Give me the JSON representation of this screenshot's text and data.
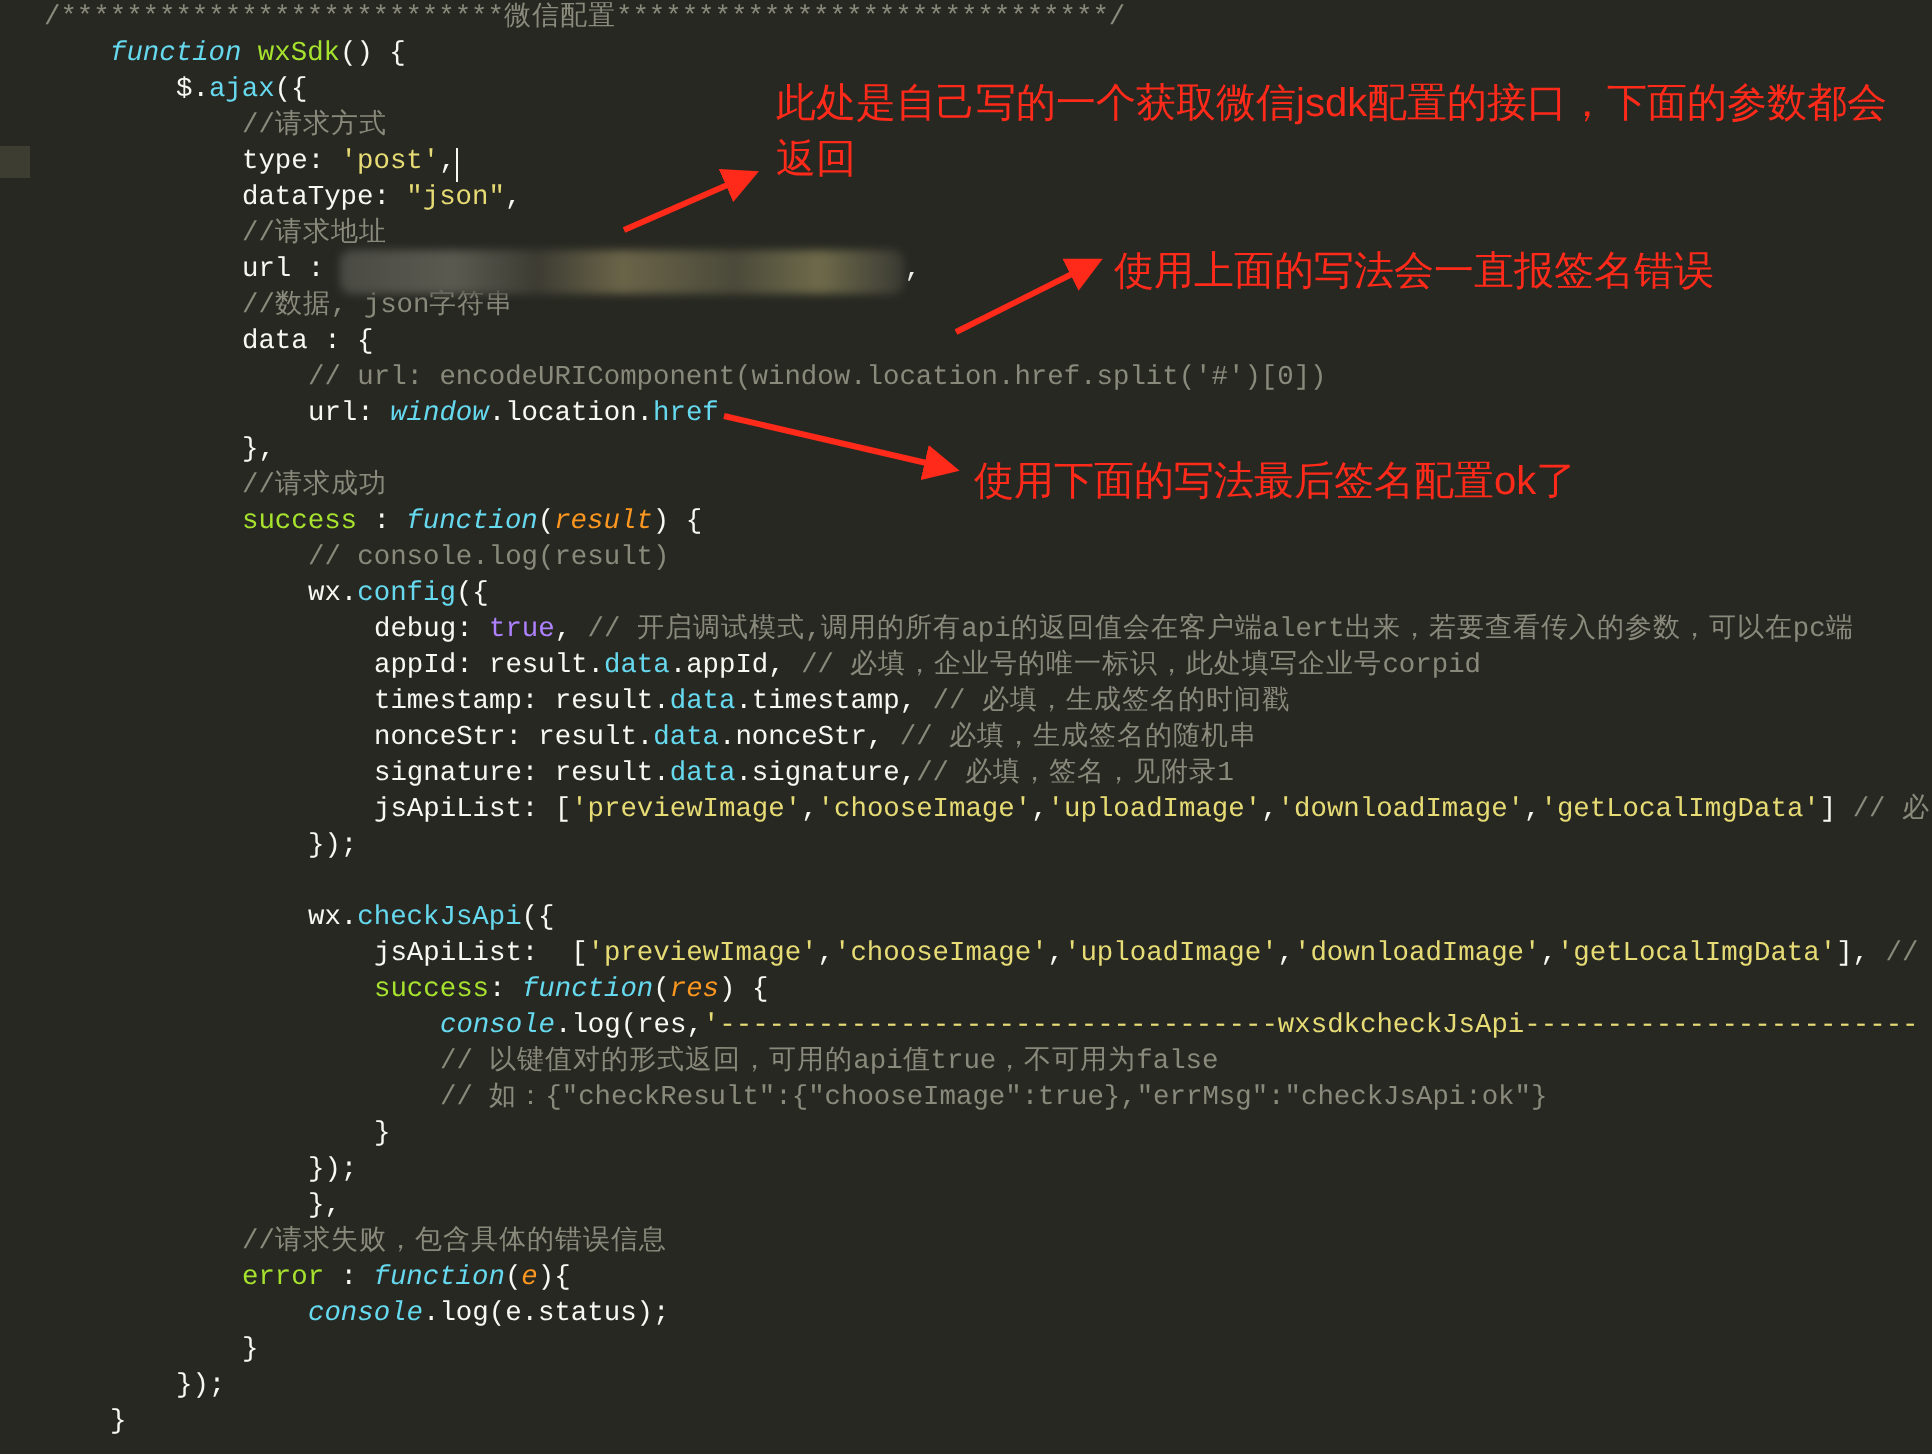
{
  "editor": {
    "lines": [
      {
        "kind": "code",
        "tokens": [
          {
            "kind": "comment",
            "text": "/***************************微信配置******************************/"
          }
        ],
        "children": [
          {
            "kind": "code",
            "tokens": [
              {
                "kind": "keyword",
                "text": "function"
              },
              {
                "kind": "name",
                "text": " wxSdk"
              },
              {
                "kind": "plain",
                "text": "() {"
              }
            ],
            "children": [
              {
                "kind": "code",
                "tokens": [
                  {
                    "kind": "plain",
                    "text": "$."
                  },
                  {
                    "kind": "prop",
                    "text": "ajax"
                  },
                  {
                    "kind": "plain",
                    "text": "({"
                  }
                ],
                "children": [
                  {
                    "kind": "code",
                    "tokens": [
                      {
                        "kind": "comment",
                        "text": "//请求方式"
                      }
                    ]
                  },
                  {
                    "kind": "code",
                    "tokens": [
                      {
                        "kind": "plain",
                        "text": "type: "
                      },
                      {
                        "kind": "string",
                        "text": "'post'"
                      },
                      {
                        "kind": "plain",
                        "text": ","
                      },
                      {
                        "kind": "cursor"
                      }
                    ]
                  },
                  {
                    "kind": "code",
                    "tokens": [
                      {
                        "kind": "plain",
                        "text": "dataType: "
                      },
                      {
                        "kind": "string",
                        "text": "\"json\""
                      },
                      {
                        "kind": "plain",
                        "text": ","
                      }
                    ]
                  },
                  {
                    "kind": "code",
                    "tokens": [
                      {
                        "kind": "comment",
                        "text": "//请求地址"
                      }
                    ]
                  },
                  {
                    "kind": "code",
                    "tokens": [
                      {
                        "kind": "plain",
                        "text": "url : "
                      },
                      {
                        "kind": "redacted"
                      },
                      {
                        "kind": "plain",
                        "text": ","
                      }
                    ]
                  },
                  {
                    "kind": "code",
                    "tokens": [
                      {
                        "kind": "comment",
                        "text": "//数据, json字符串"
                      }
                    ]
                  },
                  {
                    "kind": "code",
                    "tokens": [
                      {
                        "kind": "plain",
                        "text": "data : {"
                      }
                    ],
                    "children": [
                      {
                        "kind": "code",
                        "tokens": [
                          {
                            "kind": "comment",
                            "text": "// url: encodeURIComponent(window.location.href.split('#')[0])"
                          }
                        ]
                      },
                      {
                        "kind": "code",
                        "tokens": [
                          {
                            "kind": "plain",
                            "text": "url: "
                          },
                          {
                            "kind": "builtin",
                            "text": "window"
                          },
                          {
                            "kind": "plain",
                            "text": ".location."
                          },
                          {
                            "kind": "prop",
                            "text": "href"
                          }
                        ]
                      }
                    ]
                  },
                  {
                    "kind": "code",
                    "tokens": [
                      {
                        "kind": "plain",
                        "text": "},"
                      }
                    ]
                  },
                  {
                    "kind": "code",
                    "tokens": [
                      {
                        "kind": "comment",
                        "text": "//请求成功"
                      }
                    ]
                  },
                  {
                    "kind": "code",
                    "tokens": [
                      {
                        "kind": "name",
                        "text": "success"
                      },
                      {
                        "kind": "plain",
                        "text": " : "
                      },
                      {
                        "kind": "keyword",
                        "text": "function"
                      },
                      {
                        "kind": "plain",
                        "text": "("
                      },
                      {
                        "kind": "param",
                        "text": "result"
                      },
                      {
                        "kind": "plain",
                        "text": ") {"
                      }
                    ],
                    "children": [
                      {
                        "kind": "code",
                        "tokens": [
                          {
                            "kind": "comment",
                            "text": "// console.log(result)"
                          }
                        ]
                      },
                      {
                        "kind": "code",
                        "tokens": [
                          {
                            "kind": "plain",
                            "text": "wx."
                          },
                          {
                            "kind": "prop",
                            "text": "config"
                          },
                          {
                            "kind": "plain",
                            "text": "({"
                          }
                        ],
                        "children": [
                          {
                            "kind": "code",
                            "tokens": [
                              {
                                "kind": "plain",
                                "text": "debug: "
                              },
                              {
                                "kind": "constant",
                                "text": "true"
                              },
                              {
                                "kind": "plain",
                                "text": ", "
                              },
                              {
                                "kind": "comment",
                                "text": "// 开启调试模式,调用的所有api的返回值会在客户端alert出来，若要查看传入的参数，可以在pc端"
                              }
                            ]
                          },
                          {
                            "kind": "code",
                            "tokens": [
                              {
                                "kind": "plain",
                                "text": "appId: result."
                              },
                              {
                                "kind": "prop",
                                "text": "data"
                              },
                              {
                                "kind": "plain",
                                "text": ".appId, "
                              },
                              {
                                "kind": "comment",
                                "text": "// 必填，企业号的唯一标识，此处填写企业号corpid"
                              }
                            ]
                          },
                          {
                            "kind": "code",
                            "tokens": [
                              {
                                "kind": "plain",
                                "text": "timestamp: result."
                              },
                              {
                                "kind": "prop",
                                "text": "data"
                              },
                              {
                                "kind": "plain",
                                "text": ".timestamp, "
                              },
                              {
                                "kind": "comment",
                                "text": "// 必填，生成签名的时间戳"
                              }
                            ]
                          },
                          {
                            "kind": "code",
                            "tokens": [
                              {
                                "kind": "plain",
                                "text": "nonceStr: result."
                              },
                              {
                                "kind": "prop",
                                "text": "data"
                              },
                              {
                                "kind": "plain",
                                "text": ".nonceStr, "
                              },
                              {
                                "kind": "comment",
                                "text": "// 必填，生成签名的随机串"
                              }
                            ]
                          },
                          {
                            "kind": "code",
                            "tokens": [
                              {
                                "kind": "plain",
                                "text": "signature: result."
                              },
                              {
                                "kind": "prop",
                                "text": "data"
                              },
                              {
                                "kind": "plain",
                                "text": ".signature,"
                              },
                              {
                                "kind": "comment",
                                "text": "// 必填，签名，见附录1"
                              }
                            ]
                          },
                          {
                            "kind": "code",
                            "tokens": [
                              {
                                "kind": "plain",
                                "text": "jsApiList: ["
                              },
                              {
                                "kind": "string",
                                "text": "'previewImage'"
                              },
                              {
                                "kind": "plain",
                                "text": ","
                              },
                              {
                                "kind": "string",
                                "text": "'chooseImage'"
                              },
                              {
                                "kind": "plain",
                                "text": ","
                              },
                              {
                                "kind": "string",
                                "text": "'uploadImage'"
                              },
                              {
                                "kind": "plain",
                                "text": ","
                              },
                              {
                                "kind": "string",
                                "text": "'downloadImage'"
                              },
                              {
                                "kind": "plain",
                                "text": ","
                              },
                              {
                                "kind": "string",
                                "text": "'getLocalImgData'"
                              },
                              {
                                "kind": "plain",
                                "text": "] "
                              },
                              {
                                "kind": "comment",
                                "text": "// 必"
                              }
                            ]
                          }
                        ]
                      },
                      {
                        "kind": "code",
                        "tokens": [
                          {
                            "kind": "plain",
                            "text": "});"
                          }
                        ]
                      },
                      {
                        "kind": "blank"
                      },
                      {
                        "kind": "code",
                        "tokens": [
                          {
                            "kind": "plain",
                            "text": "wx."
                          },
                          {
                            "kind": "prop",
                            "text": "checkJsApi"
                          },
                          {
                            "kind": "plain",
                            "text": "({"
                          }
                        ],
                        "children": [
                          {
                            "kind": "code",
                            "tokens": [
                              {
                                "kind": "plain",
                                "text": "jsApiList:  ["
                              },
                              {
                                "kind": "string",
                                "text": "'previewImage'"
                              },
                              {
                                "kind": "plain",
                                "text": ","
                              },
                              {
                                "kind": "string",
                                "text": "'chooseImage'"
                              },
                              {
                                "kind": "plain",
                                "text": ","
                              },
                              {
                                "kind": "string",
                                "text": "'uploadImage'"
                              },
                              {
                                "kind": "plain",
                                "text": ","
                              },
                              {
                                "kind": "string",
                                "text": "'downloadImage'"
                              },
                              {
                                "kind": "plain",
                                "text": ","
                              },
                              {
                                "kind": "string",
                                "text": "'getLocalImgData'"
                              },
                              {
                                "kind": "plain",
                                "text": "], "
                              },
                              {
                                "kind": "comment",
                                "text": "//"
                              }
                            ]
                          },
                          {
                            "kind": "code",
                            "tokens": [
                              {
                                "kind": "name",
                                "text": "success"
                              },
                              {
                                "kind": "plain",
                                "text": ": "
                              },
                              {
                                "kind": "keyword",
                                "text": "function"
                              },
                              {
                                "kind": "plain",
                                "text": "("
                              },
                              {
                                "kind": "param",
                                "text": "res"
                              },
                              {
                                "kind": "plain",
                                "text": ") {"
                              }
                            ],
                            "children": [
                              {
                                "kind": "code",
                                "tokens": [
                                  {
                                    "kind": "builtin",
                                    "text": "console"
                                  },
                                  {
                                    "kind": "plain",
                                    "text": ".log(res,"
                                  },
                                  {
                                    "kind": "string",
                                    "text": "'----------------------------------wxsdkcheckJsApi------------------------"
                                  }
                                ]
                              },
                              {
                                "kind": "code",
                                "tokens": [
                                  {
                                    "kind": "comment",
                                    "text": "// 以键值对的形式返回，可用的api值true，不可用为false"
                                  }
                                ]
                              },
                              {
                                "kind": "code",
                                "tokens": [
                                  {
                                    "kind": "comment",
                                    "text": "// 如：{\"checkResult\":{\"chooseImage\":true},\"errMsg\":\"checkJsApi:ok\"}"
                                  }
                                ]
                              }
                            ]
                          },
                          {
                            "kind": "code",
                            "tokens": [
                              {
                                "kind": "plain",
                                "text": "}"
                              }
                            ]
                          }
                        ]
                      },
                      {
                        "kind": "code",
                        "tokens": [
                          {
                            "kind": "plain",
                            "text": "});"
                          }
                        ]
                      },
                      {
                        "kind": "code",
                        "tokens": [
                          {
                            "kind": "plain",
                            "text": "},"
                          }
                        ]
                      }
                    ]
                  },
                  {
                    "kind": "code",
                    "tokens": [
                      {
                        "kind": "comment",
                        "text": "//请求失败，包含具体的错误信息"
                      }
                    ]
                  },
                  {
                    "kind": "code",
                    "tokens": [
                      {
                        "kind": "name",
                        "text": "error"
                      },
                      {
                        "kind": "plain",
                        "text": " : "
                      },
                      {
                        "kind": "keyword",
                        "text": "function"
                      },
                      {
                        "kind": "plain",
                        "text": "("
                      },
                      {
                        "kind": "param",
                        "text": "e"
                      },
                      {
                        "kind": "plain",
                        "text": "){"
                      }
                    ],
                    "children": [
                      {
                        "kind": "code",
                        "tokens": [
                          {
                            "kind": "builtin",
                            "text": "console"
                          },
                          {
                            "kind": "plain",
                            "text": ".log(e.status);"
                          }
                        ]
                      }
                    ]
                  },
                  {
                    "kind": "code",
                    "tokens": [
                      {
                        "kind": "plain",
                        "text": "}"
                      }
                    ]
                  }
                ]
              },
              {
                "kind": "code",
                "tokens": [
                  {
                    "kind": "plain",
                    "text": "});"
                  }
                ]
              }
            ]
          },
          {
            "kind": "code",
            "tokens": [
              {
                "kind": "plain",
                "text": "}"
              }
            ]
          }
        ]
      }
    ]
  },
  "annotations": [
    {
      "text": "此处是自己写的一个获取微信jsdk配置的接口，下面的参数都会返回"
    },
    {
      "text": "使用上面的写法会一直报签名错误"
    },
    {
      "text": "使用下面的写法最后签名配置ok了"
    }
  ]
}
